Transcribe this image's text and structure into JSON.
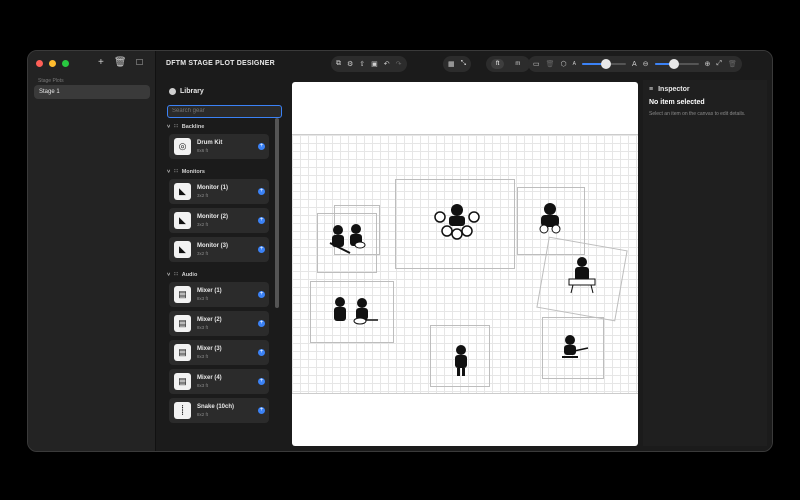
{
  "sidebar": {
    "section_label": "Stage Plots",
    "items": [
      {
        "label": "Stage 1"
      }
    ],
    "icons": [
      "plus-icon",
      "trash-icon",
      "sidebar-toggle-icon"
    ]
  },
  "app": {
    "title": "DFTM STAGE PLOT DESIGNER"
  },
  "toolbar": {
    "units": {
      "ft": "ft",
      "m": "m",
      "selected": "ft"
    },
    "zoom_fraction": 0.55,
    "scale_fraction": 0.45
  },
  "library": {
    "title": "Library",
    "search_placeholder": "Search gear",
    "categories": [
      {
        "name": "Backline",
        "items": [
          {
            "name": "Drum Kit",
            "size": "8x6 ft",
            "icon": "drum-kit-icon"
          }
        ]
      },
      {
        "name": "Monitors",
        "items": [
          {
            "name": "Monitor (1)",
            "size": "3x2 ft",
            "icon": "monitor-wedge-icon"
          },
          {
            "name": "Monitor (2)",
            "size": "3x2 ft",
            "icon": "monitor-wedge-icon"
          },
          {
            "name": "Monitor (3)",
            "size": "3x2 ft",
            "icon": "monitor-wedge-icon"
          }
        ]
      },
      {
        "name": "Audio",
        "items": [
          {
            "name": "Mixer (1)",
            "size": "8x3 ft",
            "icon": "mixer-icon"
          },
          {
            "name": "Mixer (2)",
            "size": "8x3 ft",
            "icon": "mixer-icon"
          },
          {
            "name": "Mixer (3)",
            "size": "8x3 ft",
            "icon": "mixer-icon"
          },
          {
            "name": "Mixer (4)",
            "size": "8x3 ft",
            "icon": "mixer-icon"
          },
          {
            "name": "Snake (10ch)",
            "size": "8x2 ft",
            "icon": "snake-icon"
          }
        ]
      }
    ]
  },
  "inspector": {
    "title": "Inspector",
    "empty_title": "No item selected",
    "empty_hint": "Select an item on the canvas to edit details."
  }
}
